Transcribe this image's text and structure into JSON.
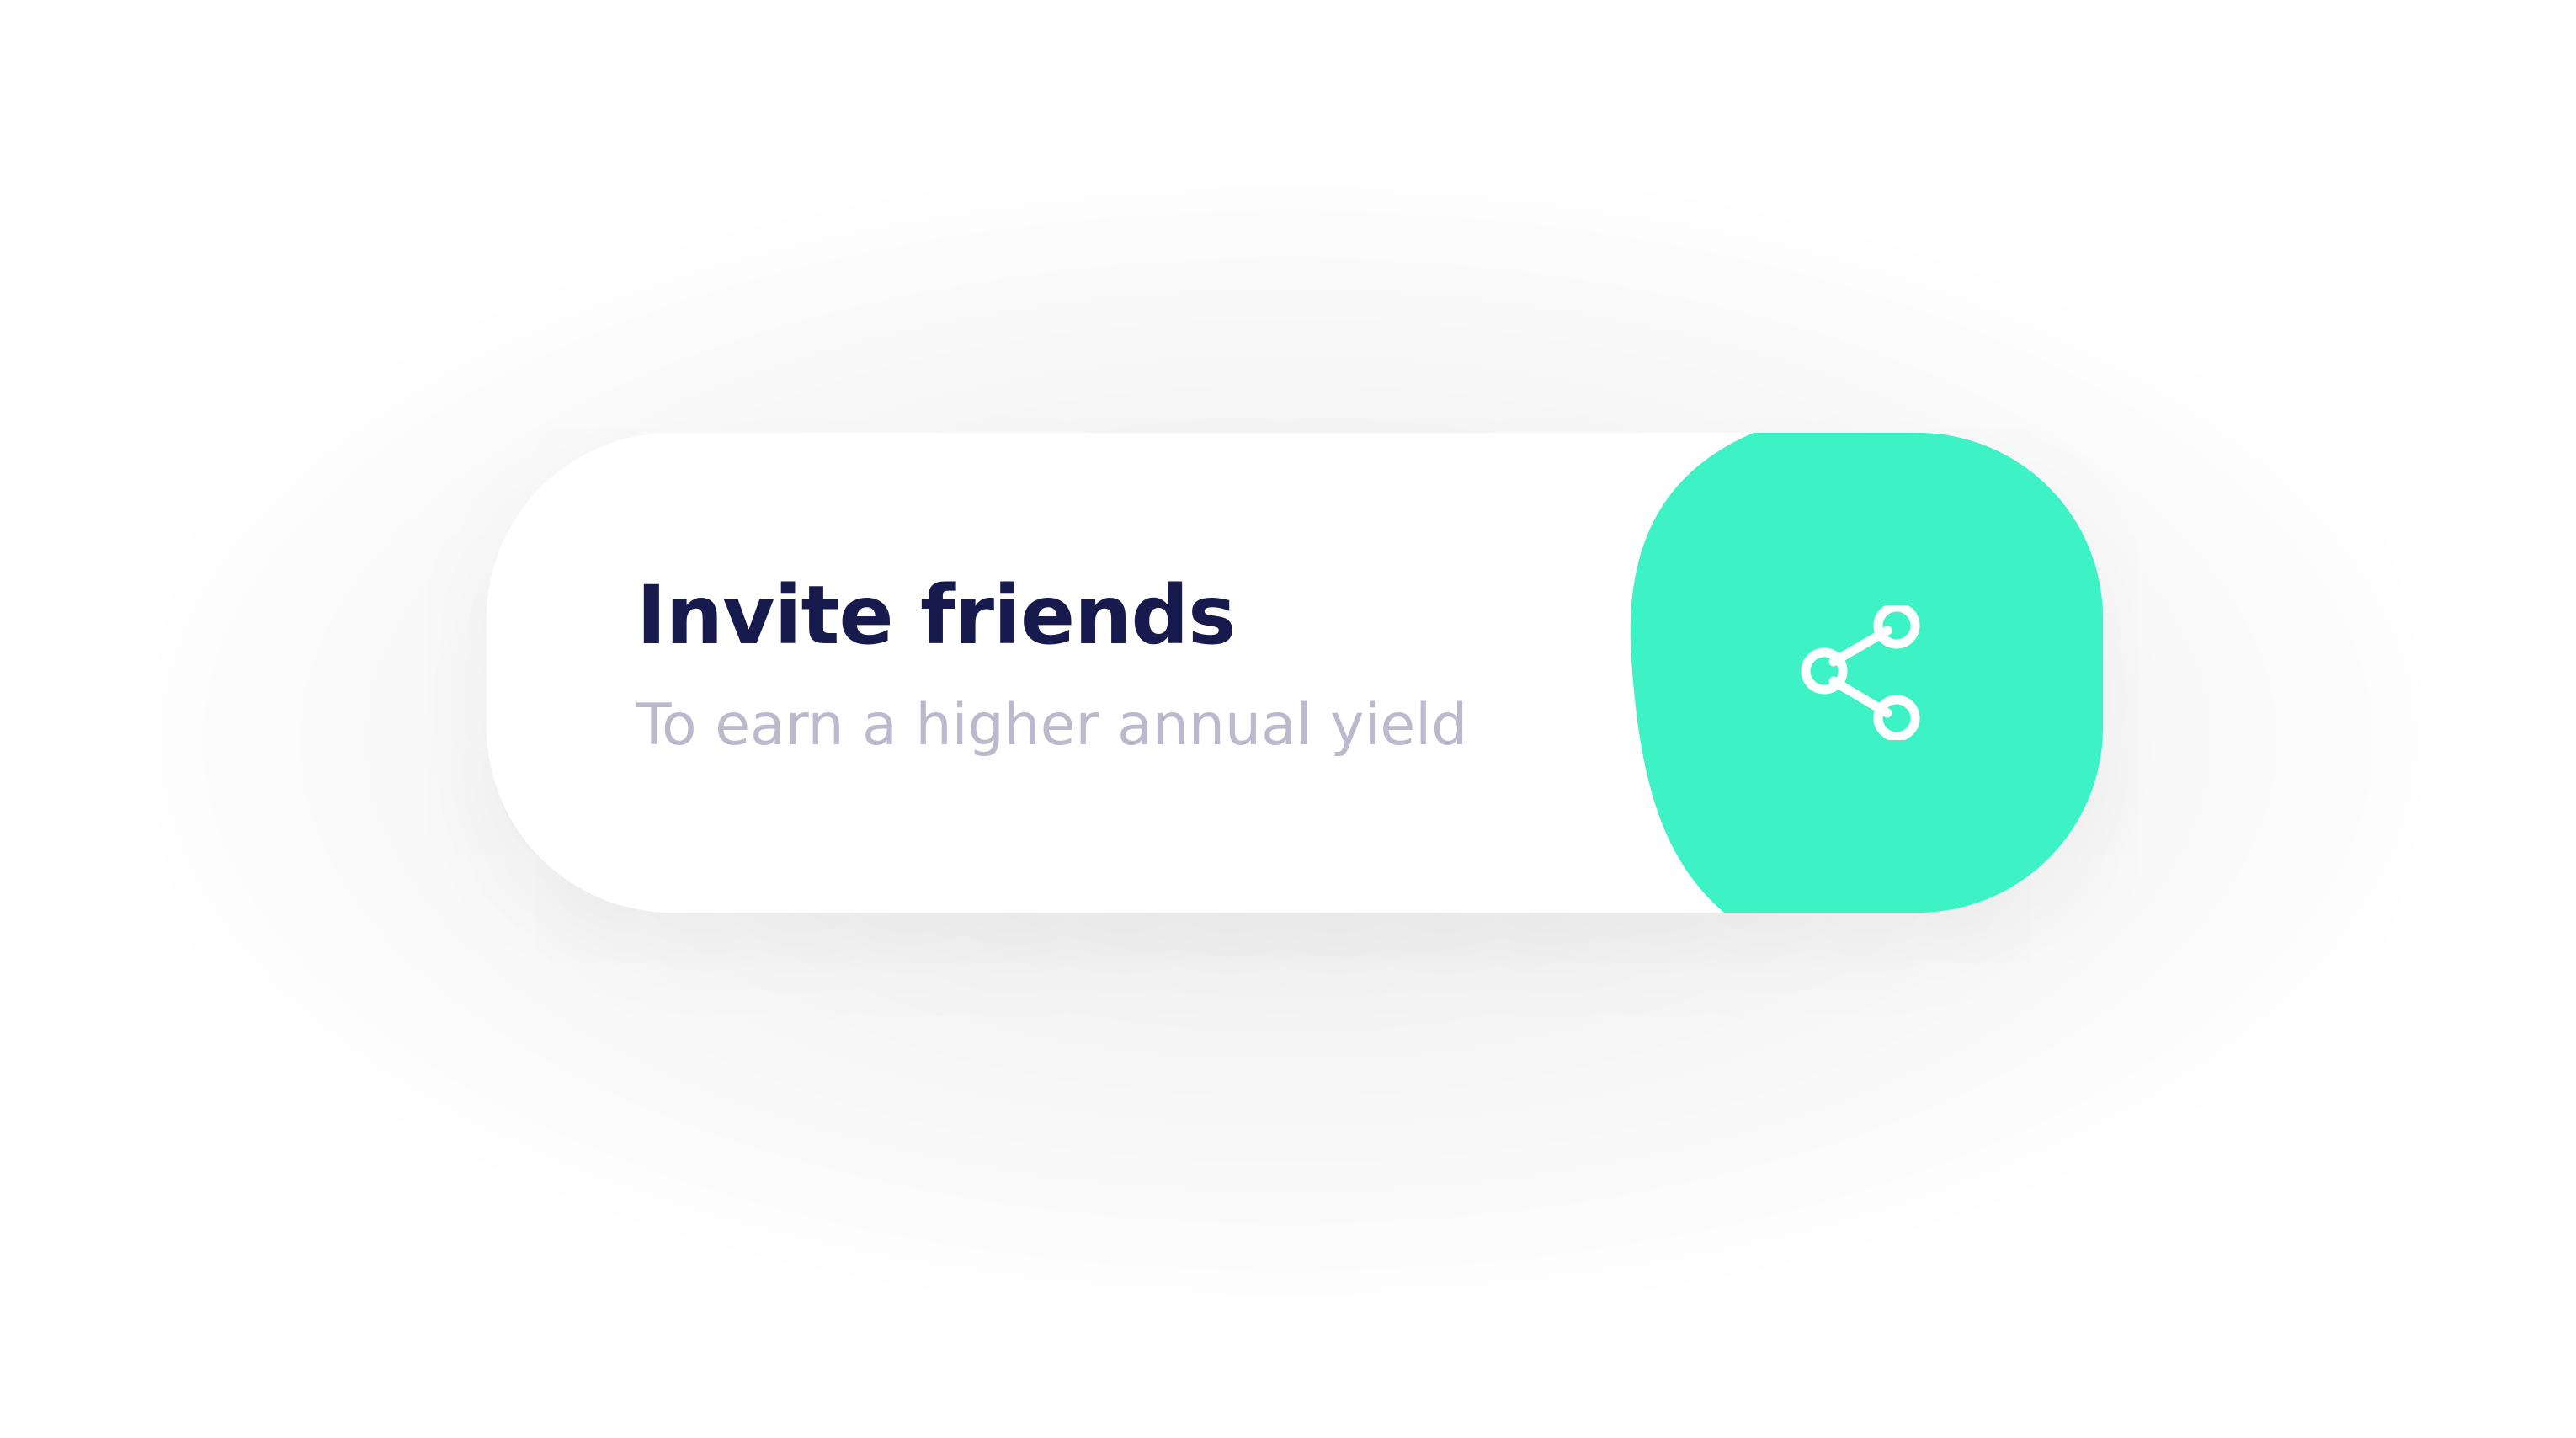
{
  "invite_card": {
    "title": "Invite friends",
    "subtitle": "To earn a higher annual yield",
    "action": {
      "icon": "share-icon"
    }
  },
  "colors": {
    "accent": "#3df2c4",
    "title": "#171a4d",
    "subtitle": "#bbb9cc",
    "card_background": "#ffffff",
    "icon": "#ffffff"
  }
}
